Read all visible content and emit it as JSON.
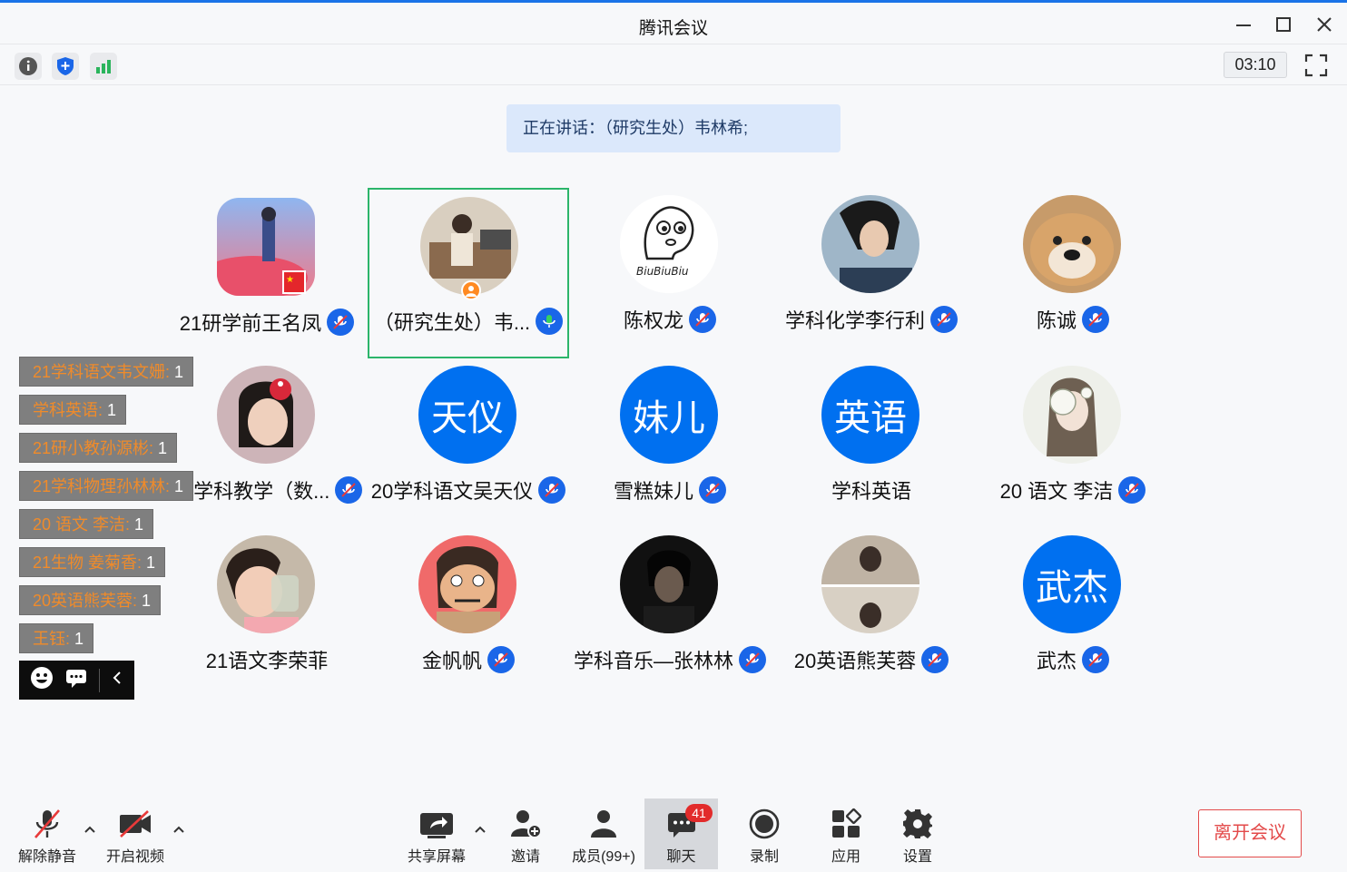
{
  "window": {
    "title": "腾讯会议"
  },
  "toolbar": {
    "timer": "03:10"
  },
  "speaking_banner": "正在讲话：（研究生处）韦林希;",
  "participants": [
    {
      "name": "21研学前王名凤",
      "avatar": "photo",
      "mic": "muted"
    },
    {
      "name": "（研究生处）韦...",
      "avatar": "photo",
      "mic": "active",
      "host": true
    },
    {
      "name": "陈权龙",
      "avatar": "cartoon",
      "mic": "muted"
    },
    {
      "name": "学科化学李行利",
      "avatar": "photo",
      "mic": "muted"
    },
    {
      "name": "陈诚",
      "avatar": "dog-photo",
      "mic": "muted"
    },
    {
      "name": "21学科教学（数...",
      "avatar": "photo",
      "mic": "muted"
    },
    {
      "name": "20学科语文吴天仪",
      "avatar_text": "天仪",
      "mic": "muted"
    },
    {
      "name": "雪糕妹儿",
      "avatar_text": "妹儿",
      "mic": "muted"
    },
    {
      "name": "学科英语",
      "avatar_text": "英语",
      "mic": "none"
    },
    {
      "name": "20 语文 李洁",
      "avatar": "photo",
      "mic": "muted"
    },
    {
      "name": "21语文李荣菲",
      "avatar": "photo",
      "mic": "none"
    },
    {
      "name": "金帆帆",
      "avatar": "cartoon",
      "mic": "muted"
    },
    {
      "name": "学科音乐—张林林",
      "avatar": "photo",
      "mic": "muted"
    },
    {
      "name": "20英语熊芙蓉",
      "avatar": "photo",
      "mic": "muted"
    },
    {
      "name": "武杰",
      "avatar_text": "武杰",
      "mic": "muted"
    }
  ],
  "chat_tags": [
    {
      "name": "21学科语文韦文姗:",
      "count": "1"
    },
    {
      "name": "学科英语:",
      "count": "1"
    },
    {
      "name": "21研小教孙源彬:",
      "count": "1"
    },
    {
      "name": "21学科物理孙林林:",
      "count": "1"
    },
    {
      "name": "20 语文 李洁:",
      "count": "1"
    },
    {
      "name": "21生物  姜菊香:",
      "count": "1"
    },
    {
      "name": "20英语熊芙蓉:",
      "count": "1"
    },
    {
      "name": "王钰:",
      "count": "1"
    }
  ],
  "bottom": {
    "unmute": "解除静音",
    "start_video": "开启视频",
    "share_screen": "共享屏幕",
    "invite": "邀请",
    "members": "成员(99+)",
    "chat": "聊天",
    "chat_badge": "41",
    "record": "录制",
    "apps": "应用",
    "settings": "设置",
    "leave": "离开会议"
  },
  "colors": {
    "accent": "#1a66e8",
    "active_border": "#2cb56a",
    "leave": "#e34a4a"
  }
}
